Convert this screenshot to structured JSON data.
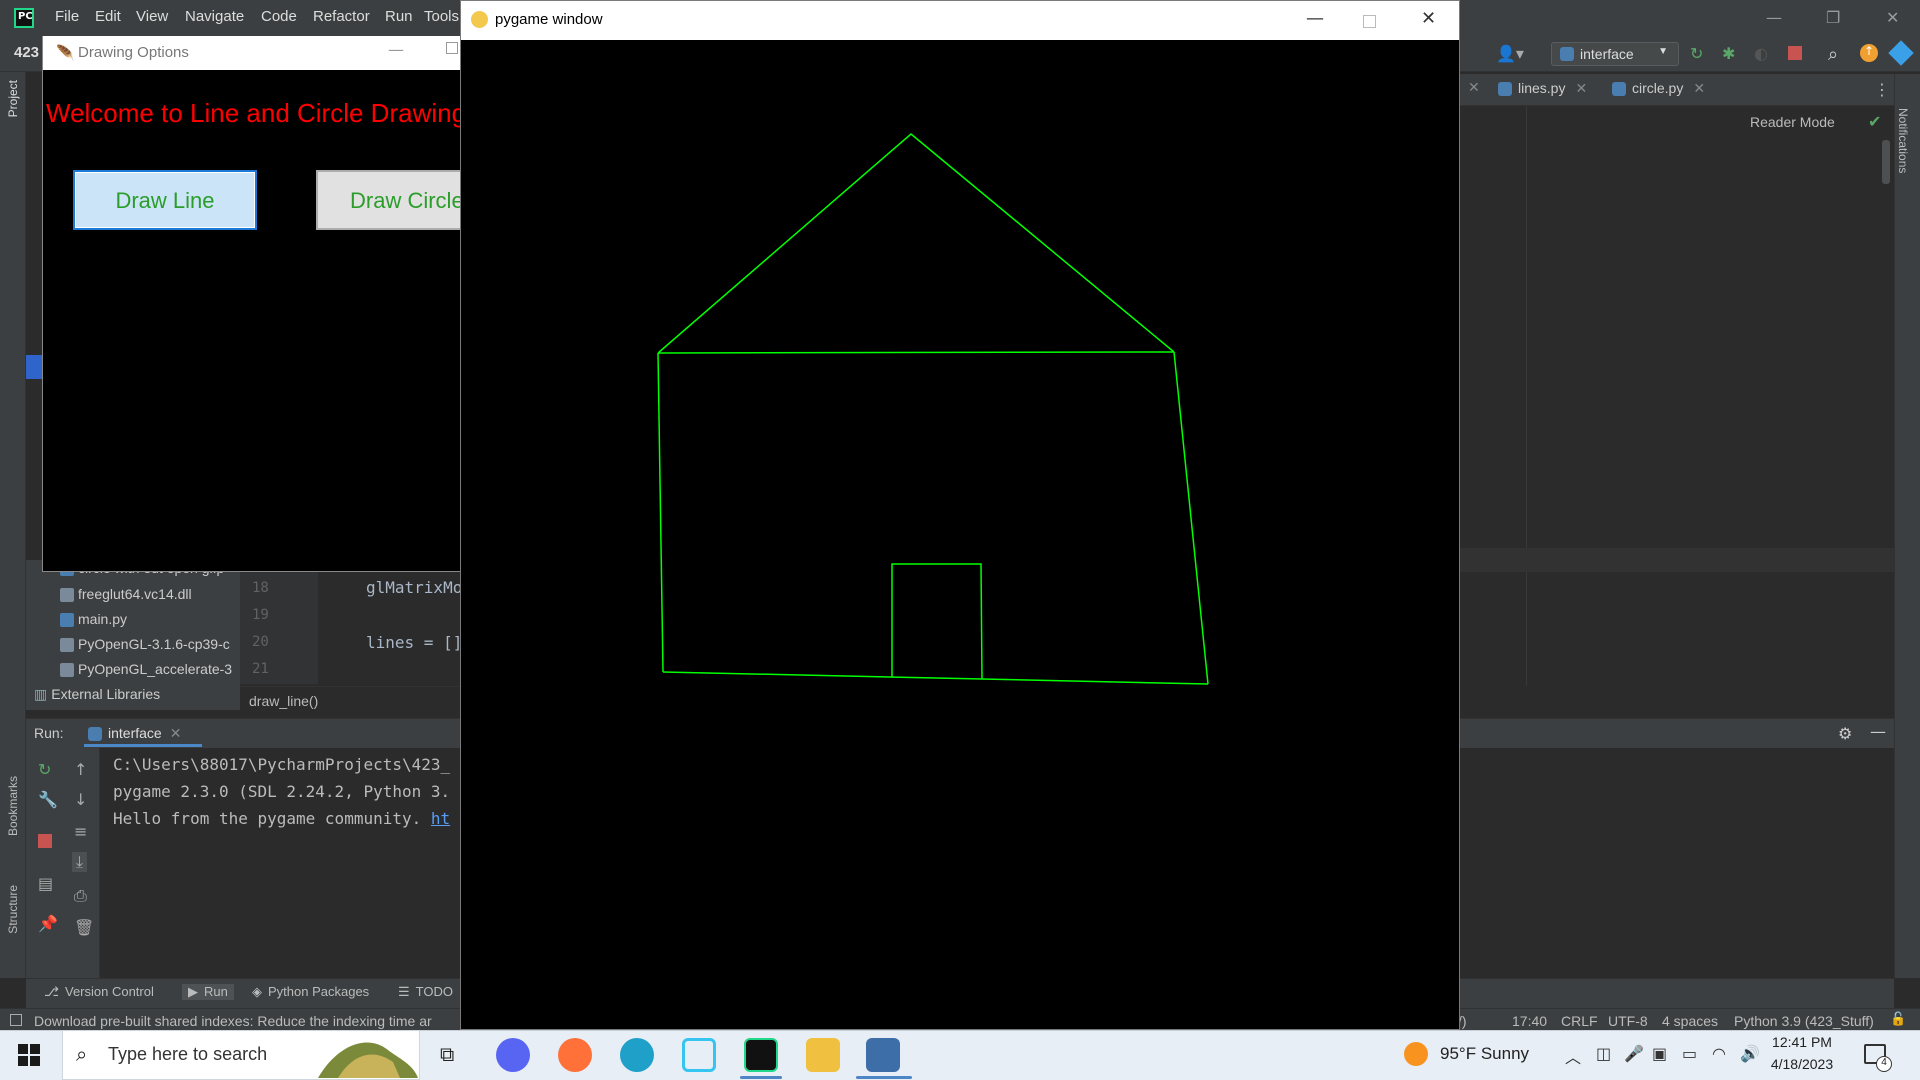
{
  "ide": {
    "menu": [
      "File",
      "Edit",
      "View",
      "Navigate",
      "Code",
      "Refactor",
      "Run",
      "Tools"
    ],
    "project_short": "423",
    "run_config": "interface",
    "tabs": [
      "lines.py",
      "circle.py"
    ],
    "reader_mode": "Reader Mode",
    "left_labels": {
      "project": "Project",
      "bookmarks": "Bookmarks",
      "structure": "Structure"
    },
    "notifications_label": "Notifications",
    "tree": [
      {
        "label": "circle with out open gl.p"
      },
      {
        "label": "freeglut64.vc14.dll"
      },
      {
        "label": "main.py"
      },
      {
        "label": "PyOpenGL-3.1.6-cp39-c"
      },
      {
        "label": "PyOpenGL_accelerate-3"
      }
    ],
    "external_libraries": "External Libraries",
    "code_lines": [
      {
        "num": "18",
        "text": "glMatrixMo"
      },
      {
        "num": "19",
        "text": ""
      },
      {
        "num": "20",
        "text": "lines = []"
      },
      {
        "num": "21",
        "text": ""
      }
    ],
    "breadcrumb": "draw_line()",
    "run_panel": {
      "label": "Run:",
      "tab": "interface",
      "console": [
        "C:\\Users\\88017\\PycharmProjects\\423_",
        "pygame 2.3.0 (SDL 2.24.2, Python 3.",
        "Hello from the pygame community. "
      ],
      "console_link": "ht"
    },
    "bottom_tabs": [
      "Version Control",
      "Run",
      "Python Packages",
      "TODO"
    ],
    "status": {
      "message": "Download pre-built shared indexes: Reduce the indexing time ar",
      "partial": "/)",
      "position": "17:40",
      "line_sep": "CRLF",
      "encoding": "UTF-8",
      "indent": "4 spaces",
      "interpreter": "Python 3.9 (423_Stuff)"
    }
  },
  "drawing_options": {
    "title": "Drawing Options",
    "welcome": "Welcome to Line and Circle Drawing",
    "btn_line": "Draw Line",
    "btn_circle": "Draw Circle"
  },
  "pygame": {
    "title": "pygame window",
    "line_color": "#00ff00"
  },
  "taskbar": {
    "search_placeholder": "Type here to search",
    "weather": "95°F  Sunny",
    "time": "12:41 PM",
    "date": "4/18/2023",
    "notification_count": "4"
  },
  "colors": {
    "ide_bg": "#2b2b2b",
    "ide_panel": "#3c3f41",
    "welcome_red": "#ff0000",
    "button_text_green": "#2a9d2a"
  }
}
